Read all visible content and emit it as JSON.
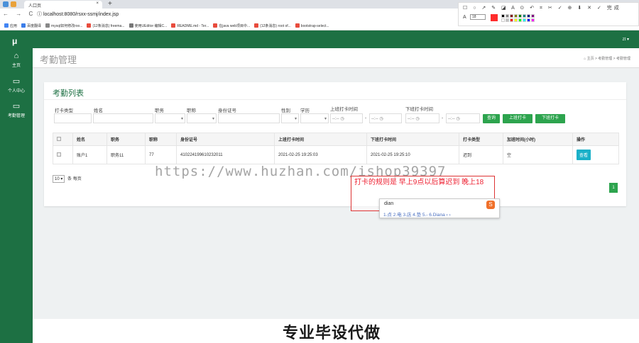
{
  "browser": {
    "tab_title": "人口页",
    "tab_close": "×",
    "new_tab": "+",
    "nav_buttons": "← → C",
    "url_prefix": "ⓘ",
    "url": "localhost:8080/rsxx-ssmj/index.jsp",
    "bookmarks": [
      {
        "label": "应用",
        "color": "#4285f4"
      },
      {
        "label": "百度翻译",
        "color": "#3b7de9"
      },
      {
        "label": "mysql如何修改roo...",
        "color": "#888888"
      },
      {
        "label": "(12条消息) freema...",
        "color": "#e84c3d"
      },
      {
        "label": "使用UEditor 编辑C...",
        "color": "#777777"
      },
      {
        "label": "README.md - Ter...",
        "color": "#e84c3d"
      },
      {
        "label": "在java web项目中...",
        "color": "#e84c3d"
      },
      {
        "label": "(12条消息) root of...",
        "color": "#e84c3d"
      },
      {
        "label": "bootstrap-select...",
        "color": "#e84c3d"
      }
    ]
  },
  "toolpanel": {
    "tools": "☐ ○ ↗ ✎ ◪ A ⊙ ↶ ⌗ ✂ ✓ ⊕ ⬇ ✕ ✓ 完成",
    "font_prefix": "A",
    "font_size": "18",
    "selected_color": "#ff2c2c",
    "palette": [
      "#000000",
      "#808080",
      "#800000",
      "#808000",
      "#008000",
      "#008080",
      "#000080",
      "#800080",
      "#ffffff",
      "#c0c0c0",
      "#ff0000",
      "#ffff00",
      "#00ff00",
      "#00ffff",
      "#0000ff",
      "#ff00ff"
    ]
  },
  "app": {
    "logo": "μ",
    "user": "zt ▾",
    "sidebar": [
      {
        "icon": "⌂",
        "label": "主页"
      },
      {
        "icon": "▭",
        "label": "个人中心"
      },
      {
        "icon": "▭",
        "label": "考勤管理"
      }
    ],
    "page_title": "考勤管理",
    "breadcrumb": "⌂ 主页  >  考勤管理  >  考勤管理"
  },
  "card": {
    "title": "考勤列表",
    "filters": {
      "labels": [
        "打卡类型",
        "姓名",
        "职务",
        "职称",
        "身份证号",
        "性别",
        "学历",
        "上班打卡时间",
        "下班打卡时间"
      ],
      "time_placeholder": "--:--  ◷",
      "select_arrow": "▾",
      "dash": "-"
    },
    "buttons": {
      "search": "查询",
      "checkin": "上班打卡",
      "checkout": "下班打卡"
    },
    "table": {
      "headers": [
        "",
        "姓名",
        "职务",
        "职称",
        "身份证号",
        "上班打卡时间",
        "下班打卡时间",
        "打卡类型",
        "加班时间(小时)",
        "操作"
      ],
      "rows": [
        [
          "",
          "账户1",
          "职务11",
          "77",
          "410224199610232011",
          "2021-02-25 19:25:03",
          "2021-02-25 19:25:10",
          "迟到",
          "空",
          "查看"
        ]
      ]
    },
    "per_page_value": "10 ▾",
    "per_page_label": "条 每页",
    "page": "1"
  },
  "overlay": {
    "watermark": "https://www.huzhan.com/ishop39397",
    "note": "打卡的规则是 早上9点以后算迟到 晚上18",
    "ime_input": "dian",
    "ime_candidates": "1.点  2.电  3.店  4.垫  5.-   6.Diana  ‹ ›",
    "ime_logo": "S",
    "bottom_text": "专业毕设代做"
  }
}
